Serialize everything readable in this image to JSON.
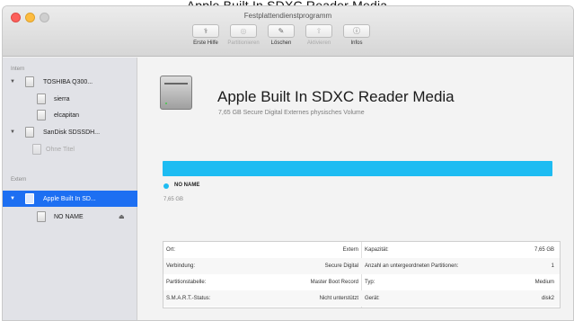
{
  "caption": "Apple Built In SDXC Reader Media",
  "window": {
    "title": "Festplattendienstprogramm"
  },
  "toolbar": {
    "items": [
      {
        "label": "Erste Hilfe",
        "icon": "stethoscope-icon",
        "glyph": "⚕",
        "enabled": true
      },
      {
        "label": "Partitionieren",
        "icon": "partition-icon",
        "glyph": "◎",
        "enabled": false
      },
      {
        "label": "Löschen",
        "icon": "erase-icon",
        "glyph": "✎",
        "enabled": true
      },
      {
        "label": "Aktivieren",
        "icon": "mount-icon",
        "glyph": "⇪",
        "enabled": false
      },
      {
        "label": "Infos",
        "icon": "info-icon",
        "glyph": "ⓘ",
        "enabled": true
      }
    ]
  },
  "sidebar": {
    "intern_label": "Intern",
    "extern_label": "Extern",
    "items": [
      {
        "label": "TOSHIBA Q300..."
      },
      {
        "label": "sierra"
      },
      {
        "label": "elcapitan"
      },
      {
        "label": "SanDisk SDSSDH..."
      },
      {
        "label": "Ohne Titel"
      },
      {
        "label": "Apple Built In SD..."
      },
      {
        "label": "NO NAME"
      }
    ],
    "eject_glyph": "⏏"
  },
  "volume": {
    "name": "Apple Built In SDXC Reader Media",
    "subtitle": "7,65 GB Secure Digital Externes physisches Volume"
  },
  "partition": {
    "name": "NO NAME",
    "size": "7,65 GB",
    "color": "#1ebcf2",
    "fill_fraction": 1.0
  },
  "info": {
    "rows": [
      {
        "k1": "Ort:",
        "v1": "Extern",
        "k2": "Kapazität:",
        "v2": "7,65 GB"
      },
      {
        "k1": "Verbindung:",
        "v1": "Secure Digital",
        "k2": "Anzahl an untergeordneten Partitionen:",
        "v2": "1"
      },
      {
        "k1": "Partitionstabelle:",
        "v1": "Master Boot Record",
        "k2": "Typ:",
        "v2": "Medium"
      },
      {
        "k1": "S.M.A.R.T.-Status:",
        "v1": "Nicht unterstützt",
        "k2": "Gerät:",
        "v2": "disk2"
      }
    ]
  },
  "colors": {
    "accent": "#1d6ff2",
    "usage": "#1ebcf2"
  }
}
